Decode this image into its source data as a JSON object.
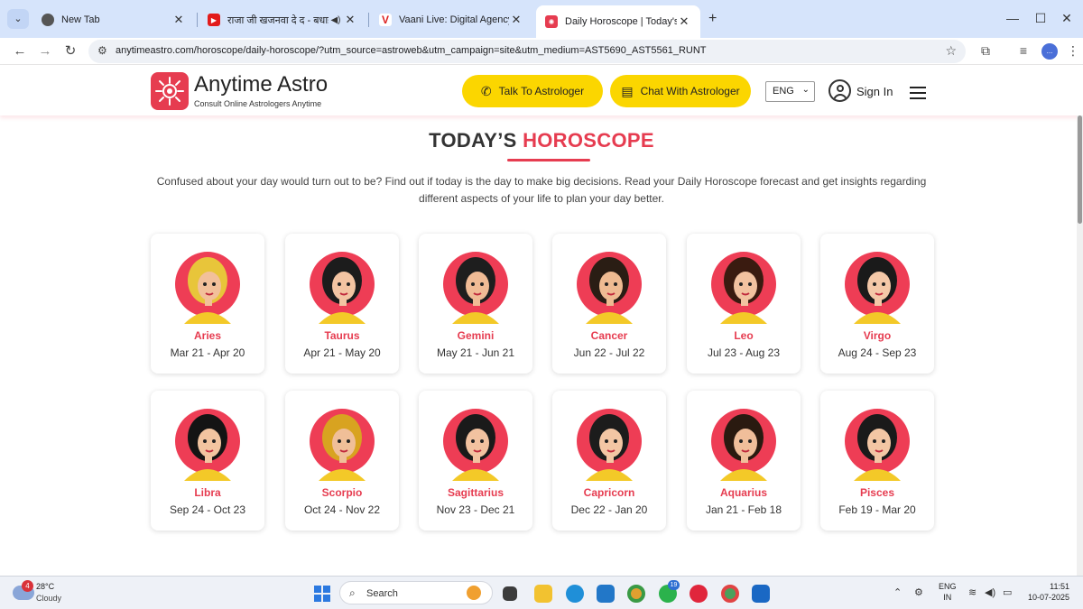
{
  "browser": {
    "tabs": [
      {
        "title": "New Tab",
        "icon": "chrome-icon"
      },
      {
        "title": "राजा जी खजनवा दे द - बधाई प",
        "icon": "youtube-icon"
      },
      {
        "title": "Vaani Live: Digital Agency, Web",
        "icon": "vaani-icon"
      },
      {
        "title": "Daily Horoscope | Today's Free",
        "icon": "anytime-astro-icon"
      }
    ],
    "active_tab": 3,
    "url": "anytimeastro.com/horoscope/daily-horoscope/?utm_source=astroweb&utm_campaign=site&utm_medium=AST5690_AST5561_RUNT",
    "profile_initials": "..."
  },
  "site": {
    "brand_name": "Anytime Astro",
    "brand_tagline": "Consult Online Astrologers Anytime",
    "talk_label": "Talk To Astrologer",
    "chat_label": "Chat With Astrologer",
    "language": "ENG",
    "signin_label": "Sign In",
    "title_part1": "TODAY’S",
    "title_part2": "HOROSCOPE",
    "intro": "Confused about your day would turn out to be? Find out if today is the day to make big decisions. Read your Daily Horoscope forecast and get insights regarding different aspects of your life to plan your day better.",
    "colors": {
      "brand": "#e63c50",
      "cta": "#fbd600"
    }
  },
  "signs": [
    {
      "name": "Aries",
      "dates": "Mar 21 - Apr 20"
    },
    {
      "name": "Taurus",
      "dates": "Apr 21 - May 20"
    },
    {
      "name": "Gemini",
      "dates": "May 21 - Jun 21"
    },
    {
      "name": "Cancer",
      "dates": "Jun 22 - Jul 22"
    },
    {
      "name": "Leo",
      "dates": "Jul 23 - Aug 23"
    },
    {
      "name": "Virgo",
      "dates": "Aug 24 - Sep 23"
    },
    {
      "name": "Libra",
      "dates": "Sep 24 - Oct 23"
    },
    {
      "name": "Scorpio",
      "dates": "Oct 24 - Nov 22"
    },
    {
      "name": "Sagittarius",
      "dates": "Nov 23 - Dec 21"
    },
    {
      "name": "Capricorn",
      "dates": "Dec 22 - Jan 20"
    },
    {
      "name": "Aquarius",
      "dates": "Jan 21 - Feb 18"
    },
    {
      "name": "Pisces",
      "dates": "Feb 19 - Mar 20"
    }
  ],
  "taskbar": {
    "weather_badge": "4",
    "temperature": "28°C",
    "condition": "Cloudy",
    "search_label": "Search",
    "whatsapp_badge": "19",
    "lang_line1": "ENG",
    "lang_line2": "IN",
    "time": "11:51",
    "date": "10-07-2025"
  }
}
